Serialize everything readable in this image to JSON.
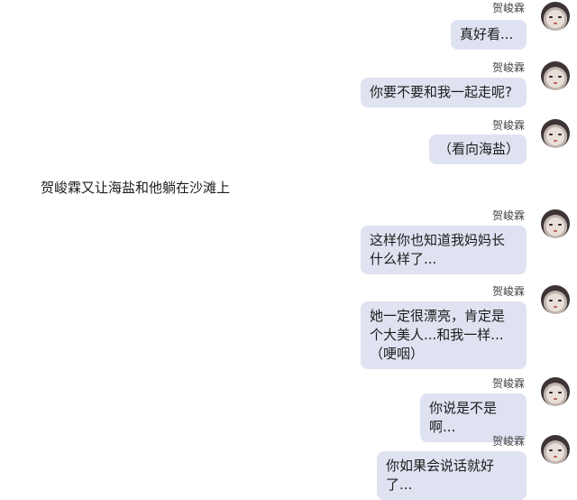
{
  "speaker": "贺峻霖",
  "narration": "贺峻霖又让海盐和他躺在沙滩上",
  "messages": [
    {
      "text": "真好看..."
    },
    {
      "text": "你要不要和我一起走呢?"
    },
    {
      "text": "（看向海盐）"
    },
    {
      "text": "这样你也知道我妈妈长什么样了..."
    },
    {
      "text": "她一定很漂亮，肯定是个大美人...和我一样...（哽咽）"
    },
    {
      "text": "你说是不是啊..."
    },
    {
      "text": "你如果会说话就好了..."
    }
  ]
}
